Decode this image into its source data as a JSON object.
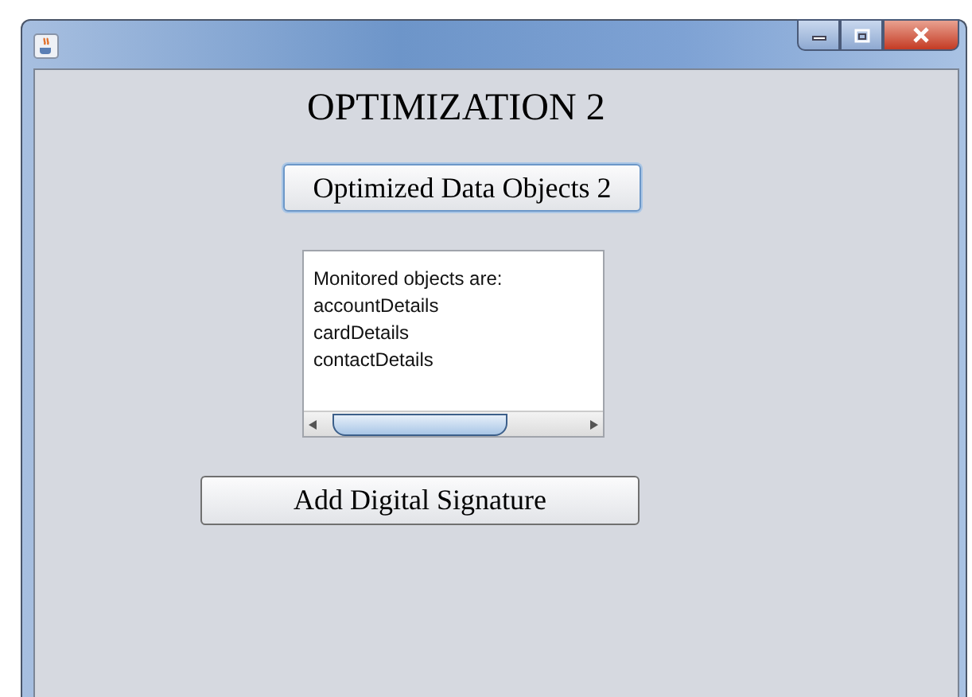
{
  "window": {
    "title_bar_buttons": [
      {
        "kind": "minimize"
      },
      {
        "kind": "maximize"
      },
      {
        "kind": "close"
      }
    ]
  },
  "heading": "OPTIMIZATION 2",
  "buttons": [
    {
      "label": "Optimized Data Objects 2",
      "focused": true
    },
    {
      "label": "Add Digital Signature",
      "focused": false
    }
  ],
  "text_area": {
    "lines": [
      "Monitored objects are:",
      "accountDetails",
      "cardDetails",
      "contactDetails"
    ]
  }
}
